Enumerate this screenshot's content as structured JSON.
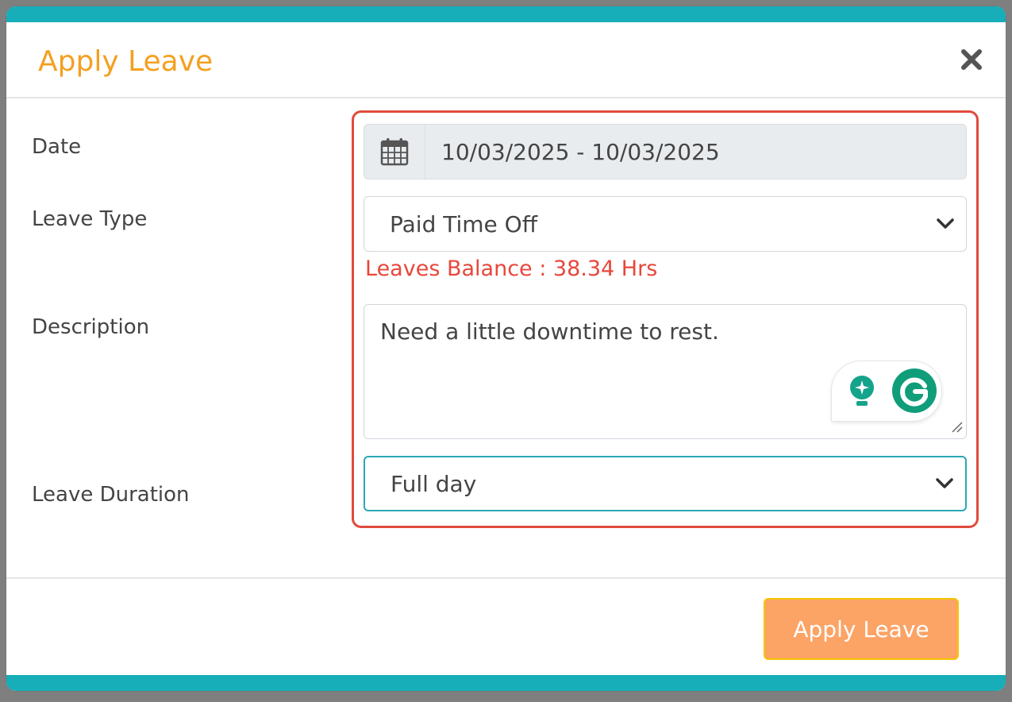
{
  "modal": {
    "title": "Apply Leave",
    "close_icon": "close-icon"
  },
  "form": {
    "date_label": "Date",
    "date_value": "10/03/2025 - 10/03/2025",
    "leave_type_label": "Leave Type",
    "leave_type_value": "Paid Time Off",
    "balance_text": "Leaves Balance : 38.34 Hrs",
    "description_label": "Description",
    "description_value": "Need a little downtime to rest.",
    "duration_label": "Leave Duration",
    "duration_value": "Full day"
  },
  "footer": {
    "apply_label": "Apply Leave"
  },
  "colors": {
    "title": "#f4a021",
    "accent_bar": "#17aeb9",
    "highlight_border": "#e04b3c",
    "balance_text": "#e8473b",
    "apply_button": "#fca366",
    "grammarly": "#0f9d7a"
  },
  "icons": [
    "calendar-icon",
    "chevron-down-icon",
    "close-icon",
    "grammarly-icon",
    "lightbulb-icon"
  ]
}
